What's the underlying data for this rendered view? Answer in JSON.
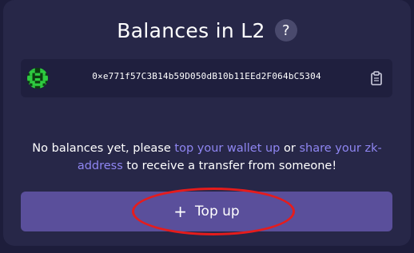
{
  "card": {
    "title": "Balances in L2",
    "help_icon": "question-mark-icon",
    "help_label": "?"
  },
  "account": {
    "avatar_icon": "identicon-avatar",
    "address": "0×e771f57C3B14b59D050dB10b11EEd2F064bC5304",
    "copy_icon": "clipboard-copy-icon"
  },
  "empty_state": {
    "text_before": "No balances yet, please ",
    "link_topup": "top your wallet up",
    "text_middle": " or ",
    "link_share": "share your zk-address",
    "text_after": " to receive a transfer from someone!"
  },
  "actions": {
    "topup_icon": "plus-icon",
    "topup_plus": "+",
    "topup_label": "Top up"
  },
  "colors": {
    "background": "#1d1d3b",
    "card": "#272748",
    "link": "#8f86f2",
    "button": "#5a4f9b",
    "annotation_ring": "#e61c1c",
    "avatar": "#2ecc40"
  }
}
